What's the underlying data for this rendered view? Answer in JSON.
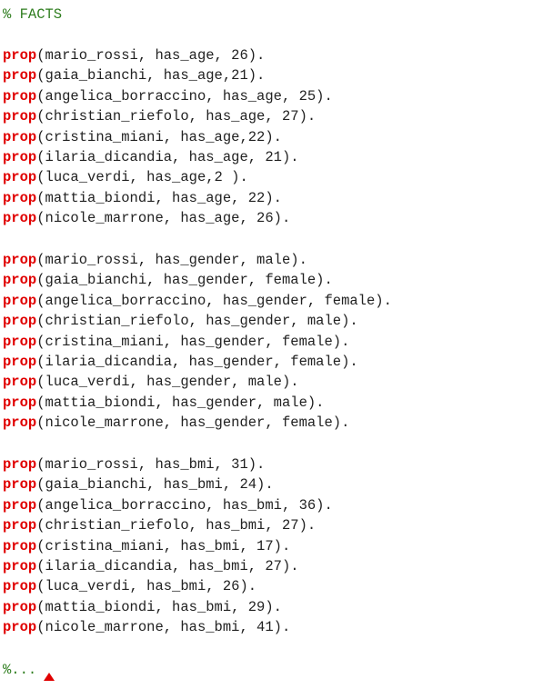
{
  "header_comment": "% FACTS",
  "keyword": "prop",
  "groups": [
    {
      "name": "age",
      "lines": [
        "(mario_rossi, has_age, 26).",
        "(gaia_bianchi, has_age,21).",
        "(angelica_borraccino, has_age, 25).",
        "(christian_riefolo, has_age, 27).",
        "(cristina_miani, has_age,22).",
        "(ilaria_dicandia, has_age, 21).",
        "(luca_verdi, has_age,2 ).",
        "(mattia_biondi, has_age, 22).",
        "(nicole_marrone, has_age, 26)."
      ]
    },
    {
      "name": "gender",
      "lines": [
        "(mario_rossi, has_gender, male).",
        "(gaia_bianchi, has_gender, female).",
        "(angelica_borraccino, has_gender, female).",
        "(christian_riefolo, has_gender, male).",
        "(cristina_miani, has_gender, female).",
        "(ilaria_dicandia, has_gender, female).",
        "(luca_verdi, has_gender, male).",
        "(mattia_biondi, has_gender, male).",
        "(nicole_marrone, has_gender, female)."
      ]
    },
    {
      "name": "bmi",
      "lines": [
        "(mario_rossi, has_bmi, 31).",
        "(gaia_bianchi, has_bmi, 24).",
        "(angelica_borraccino, has_bmi, 36).",
        "(christian_riefolo, has_bmi, 27).",
        "(cristina_miani, has_bmi, 17).",
        "(ilaria_dicandia, has_bmi, 27).",
        "(luca_verdi, has_bmi, 26).",
        "(mattia_biondi, has_bmi, 29).",
        "(nicole_marrone, has_bmi, 41)."
      ]
    }
  ],
  "footer_comment": "%...",
  "colors": {
    "comment": "#2e7d1e",
    "keyword": "#e00000",
    "text": "#222222"
  }
}
